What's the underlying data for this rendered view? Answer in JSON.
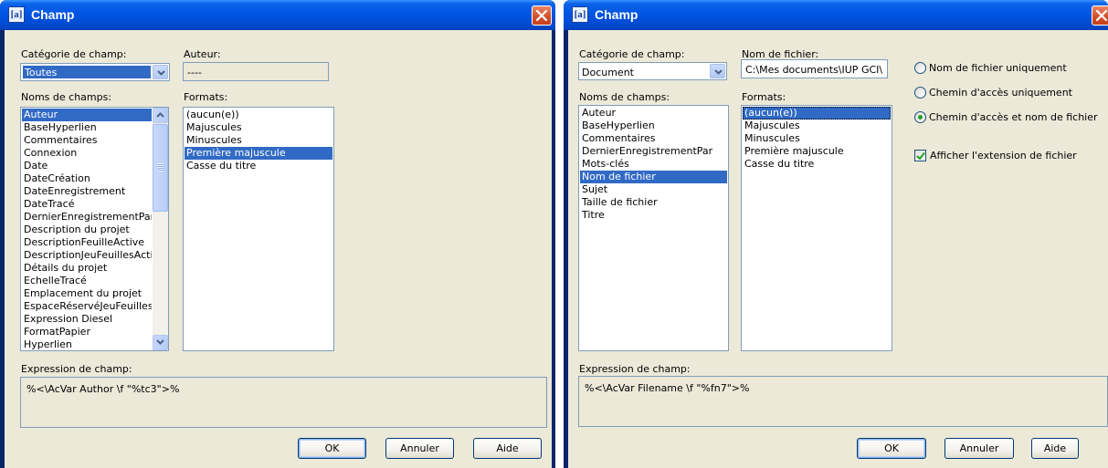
{
  "left_dialog": {
    "title": "Champ",
    "category_label": "Catégorie de champ:",
    "category_value": "Toutes",
    "author_label": "Auteur:",
    "author_value": "----",
    "field_names_label": "Noms de champs:",
    "field_names": [
      "Auteur",
      "BaseHyperlien",
      "Commentaires",
      "Connexion",
      "Date",
      "DateCréation",
      "DateEnregistrement",
      "DateTracé",
      "DernierEnregistrementPar",
      "Description du projet",
      "DescriptionFeuilleActive",
      "DescriptionJeuFeuillesActif",
      "Détails du projet",
      "EchelleTracé",
      "Emplacement du projet",
      "EspaceRéservéJeuFeuilles",
      "Expression Diesel",
      "FormatPapier",
      "Hyperlien"
    ],
    "selected_field": "Auteur",
    "formats_label": "Formats:",
    "formats": [
      "(aucun(e))",
      "Majuscules",
      "Minuscules",
      "Première majuscule",
      "Casse du titre"
    ],
    "selected_format": "Première majuscule",
    "expression_label": "Expression de champ:",
    "expression_value": "%<\\AcVar Author \\f \"%tc3\">%",
    "ok_label": "OK",
    "cancel_label": "Annuler",
    "help_label": "Aide"
  },
  "right_dialog": {
    "title": "Champ",
    "category_label": "Catégorie de champ:",
    "category_value": "Document",
    "filename_label": "Nom de fichier:",
    "filename_value": "C:\\Mes documents\\IUP GCI\\",
    "field_names_label": "Noms de champs:",
    "field_names": [
      "Auteur",
      "BaseHyperlien",
      "Commentaires",
      "DernierEnregistrementPar",
      "Mots-clés",
      "Nom de fichier",
      "Sujet",
      "Taille de fichier",
      "Titre"
    ],
    "selected_field": "Nom de fichier",
    "formats_label": "Formats:",
    "formats": [
      "(aucun(e))",
      "Majuscules",
      "Minuscules",
      "Première majuscule",
      "Casse du titre"
    ],
    "selected_format": "(aucun(e))",
    "radio_options": [
      {
        "label": "Nom de fichier uniquement",
        "checked": false
      },
      {
        "label": "Chemin d'accès uniquement",
        "checked": false
      },
      {
        "label": "Chemin d'accès et nom de fichier",
        "checked": true
      }
    ],
    "extension_checkbox_label": "Afficher l'extension de fichier",
    "extension_checked": true,
    "expression_label": "Expression de champ:",
    "expression_value": "%<\\AcVar Filename \\f \"%fn7\">%",
    "ok_label": "OK",
    "cancel_label": "Annuler",
    "help_label": "Aide"
  },
  "icons": {
    "app": "field-app-icon",
    "close": "close-x-icon",
    "dropdown": "chevron-down-icon",
    "scroll_up": "scroll-up-arrow-icon",
    "scroll_down": "scroll-down-arrow-icon"
  }
}
